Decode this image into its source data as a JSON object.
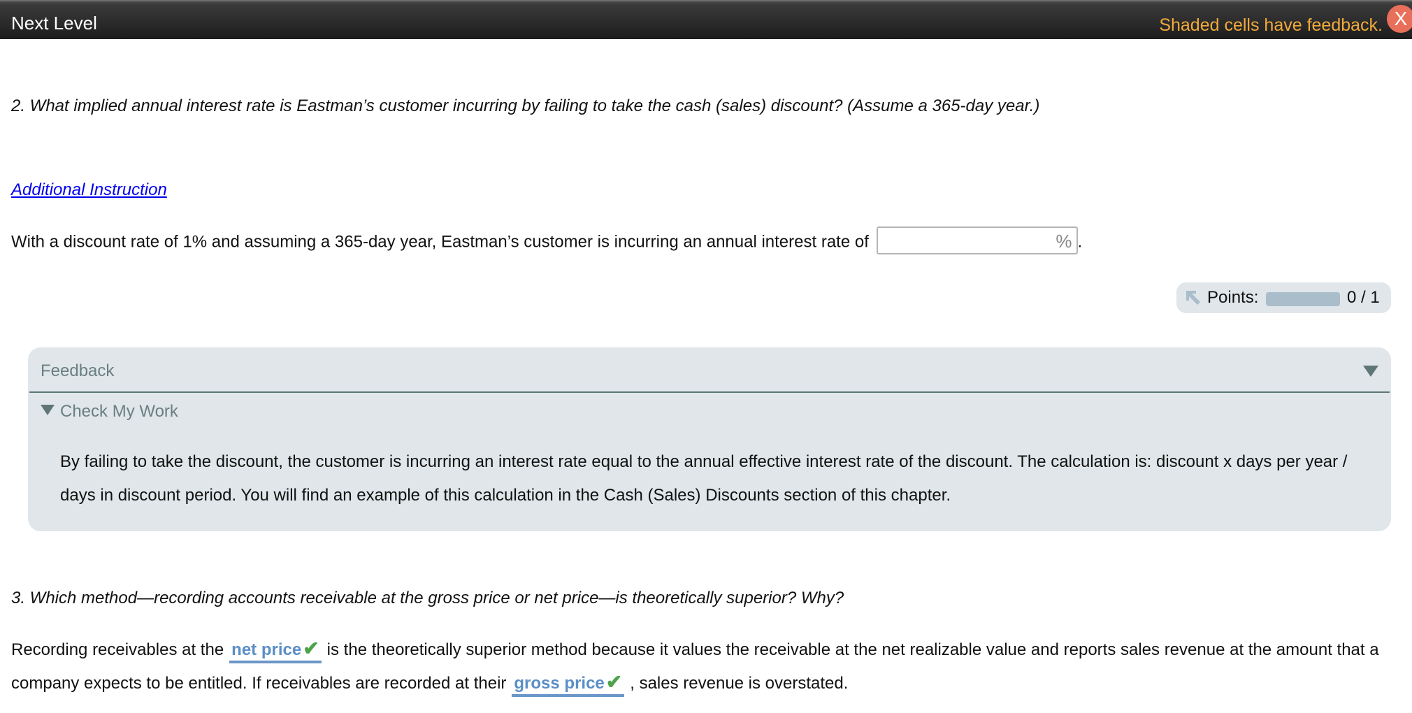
{
  "topbar": {
    "title": "Next Level",
    "note": "Shaded cells have feedback.",
    "close_label": "X"
  },
  "question2": {
    "prompt": "2. What implied annual interest rate is Eastman’s customer incurring by failing to take the cash (sales) discount? (Assume a 365-day year.)",
    "instruction_link": "Additional Instruction",
    "sentence_before": "With a discount rate of 1% and assuming a 365-day year, Eastman’s customer is incurring an annual interest rate of",
    "input_value": "",
    "unit": "%",
    "sentence_after": "."
  },
  "points": {
    "label": "Points:",
    "score": "0 / 1",
    "progress_fraction": 0
  },
  "feedback": {
    "title": "Feedback",
    "section": "Check My Work",
    "body": "By failing to take the discount, the customer is incurring an interest rate equal to the annual effective interest rate of the discount. The calculation is: discount x days per year / days in discount period. You will find an example of this calculation in the Cash (Sales) Discounts section of this chapter."
  },
  "question3": {
    "prompt": "3. Which method—recording accounts receivable at the gross price or net price—is theoretically superior? Why?",
    "part1": "Recording receivables at the",
    "answer1": "net price",
    "part2": "is the theoretically superior method because it values the receivable at the net realizable value and reports sales revenue at the amount that a company expects to be entitled. If receivables are recorded at their",
    "answer2": "gross price",
    "part3": ", sales revenue is overstated.",
    "check_glyph": "✔"
  }
}
